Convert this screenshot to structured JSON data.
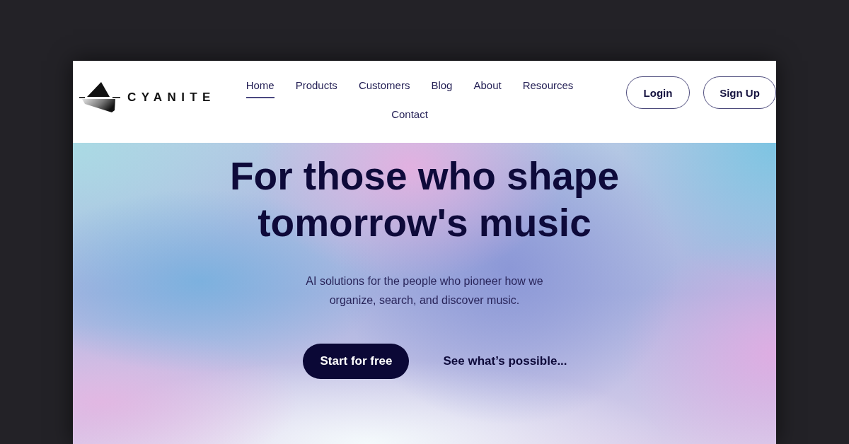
{
  "logo": {
    "wordmark": "CYANITE"
  },
  "nav": {
    "items": [
      {
        "label": "Home",
        "selected": true
      },
      {
        "label": "Products",
        "selected": false
      },
      {
        "label": "Customers",
        "selected": false
      },
      {
        "label": "Blog",
        "selected": false
      },
      {
        "label": "About",
        "selected": false
      },
      {
        "label": "Resources",
        "selected": false
      },
      {
        "label": "Contact",
        "selected": false
      }
    ]
  },
  "auth_buttons": [
    {
      "kind": "login",
      "label": "Login"
    },
    {
      "kind": "signup",
      "label": "Sign Up"
    }
  ],
  "hero": {
    "title": "For those who shape tomorrow's music",
    "subtitle": "AI solutions for the people who pioneer how we organize, search, and discover music.",
    "primary_button": "Start for free",
    "secondary_link": "See what’s possible..."
  }
}
